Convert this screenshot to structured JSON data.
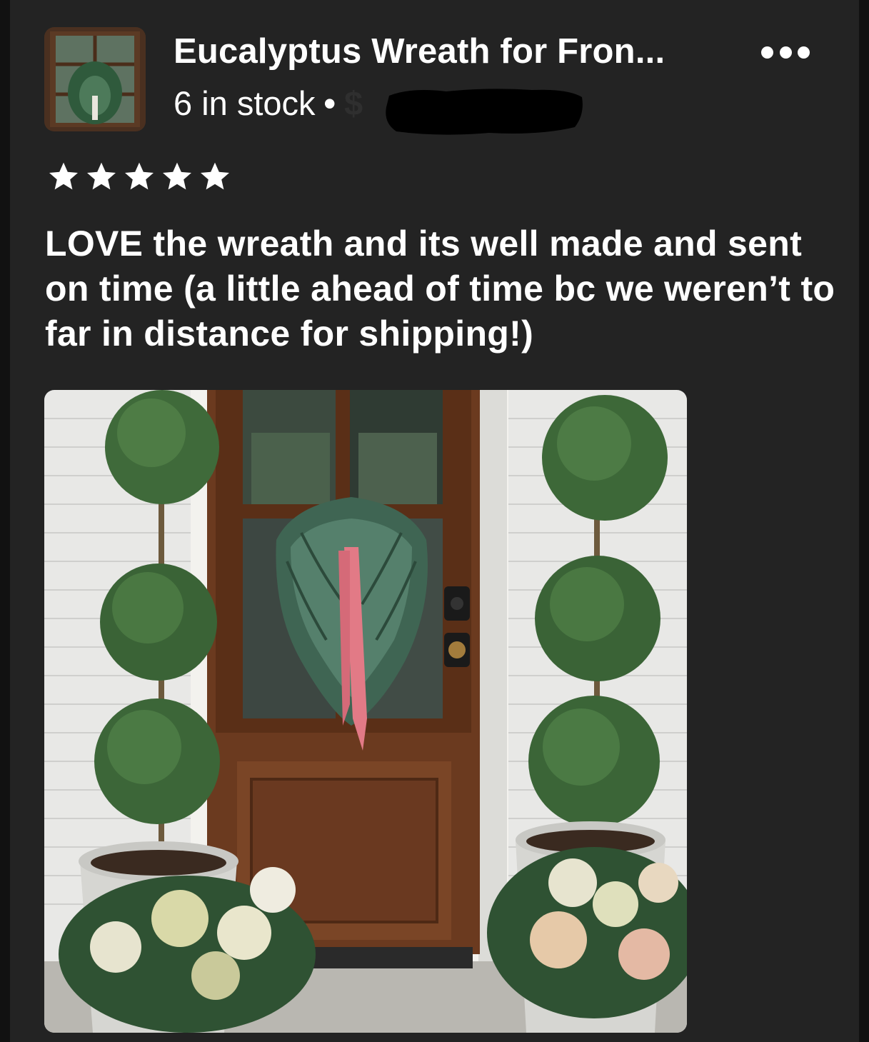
{
  "listing": {
    "title": "Eucalyptus Wreath for Fron...",
    "stock": "6 in stock",
    "separator": "•",
    "price": "$"
  },
  "review": {
    "rating": 5,
    "stars": [
      "star-1",
      "star-2",
      "star-3",
      "star-4",
      "star-5"
    ],
    "text": "LOVE the wreath and its well made and sent on time (a little ahead of time bc we weren’t to far in distance for shipping!)"
  },
  "colors": {
    "background": "#232323",
    "text": "#ffffff",
    "ribbon": "#e27a86",
    "door": "#6b3a1f"
  },
  "icons": {
    "more": "more-options-icon",
    "star": "star-icon"
  }
}
